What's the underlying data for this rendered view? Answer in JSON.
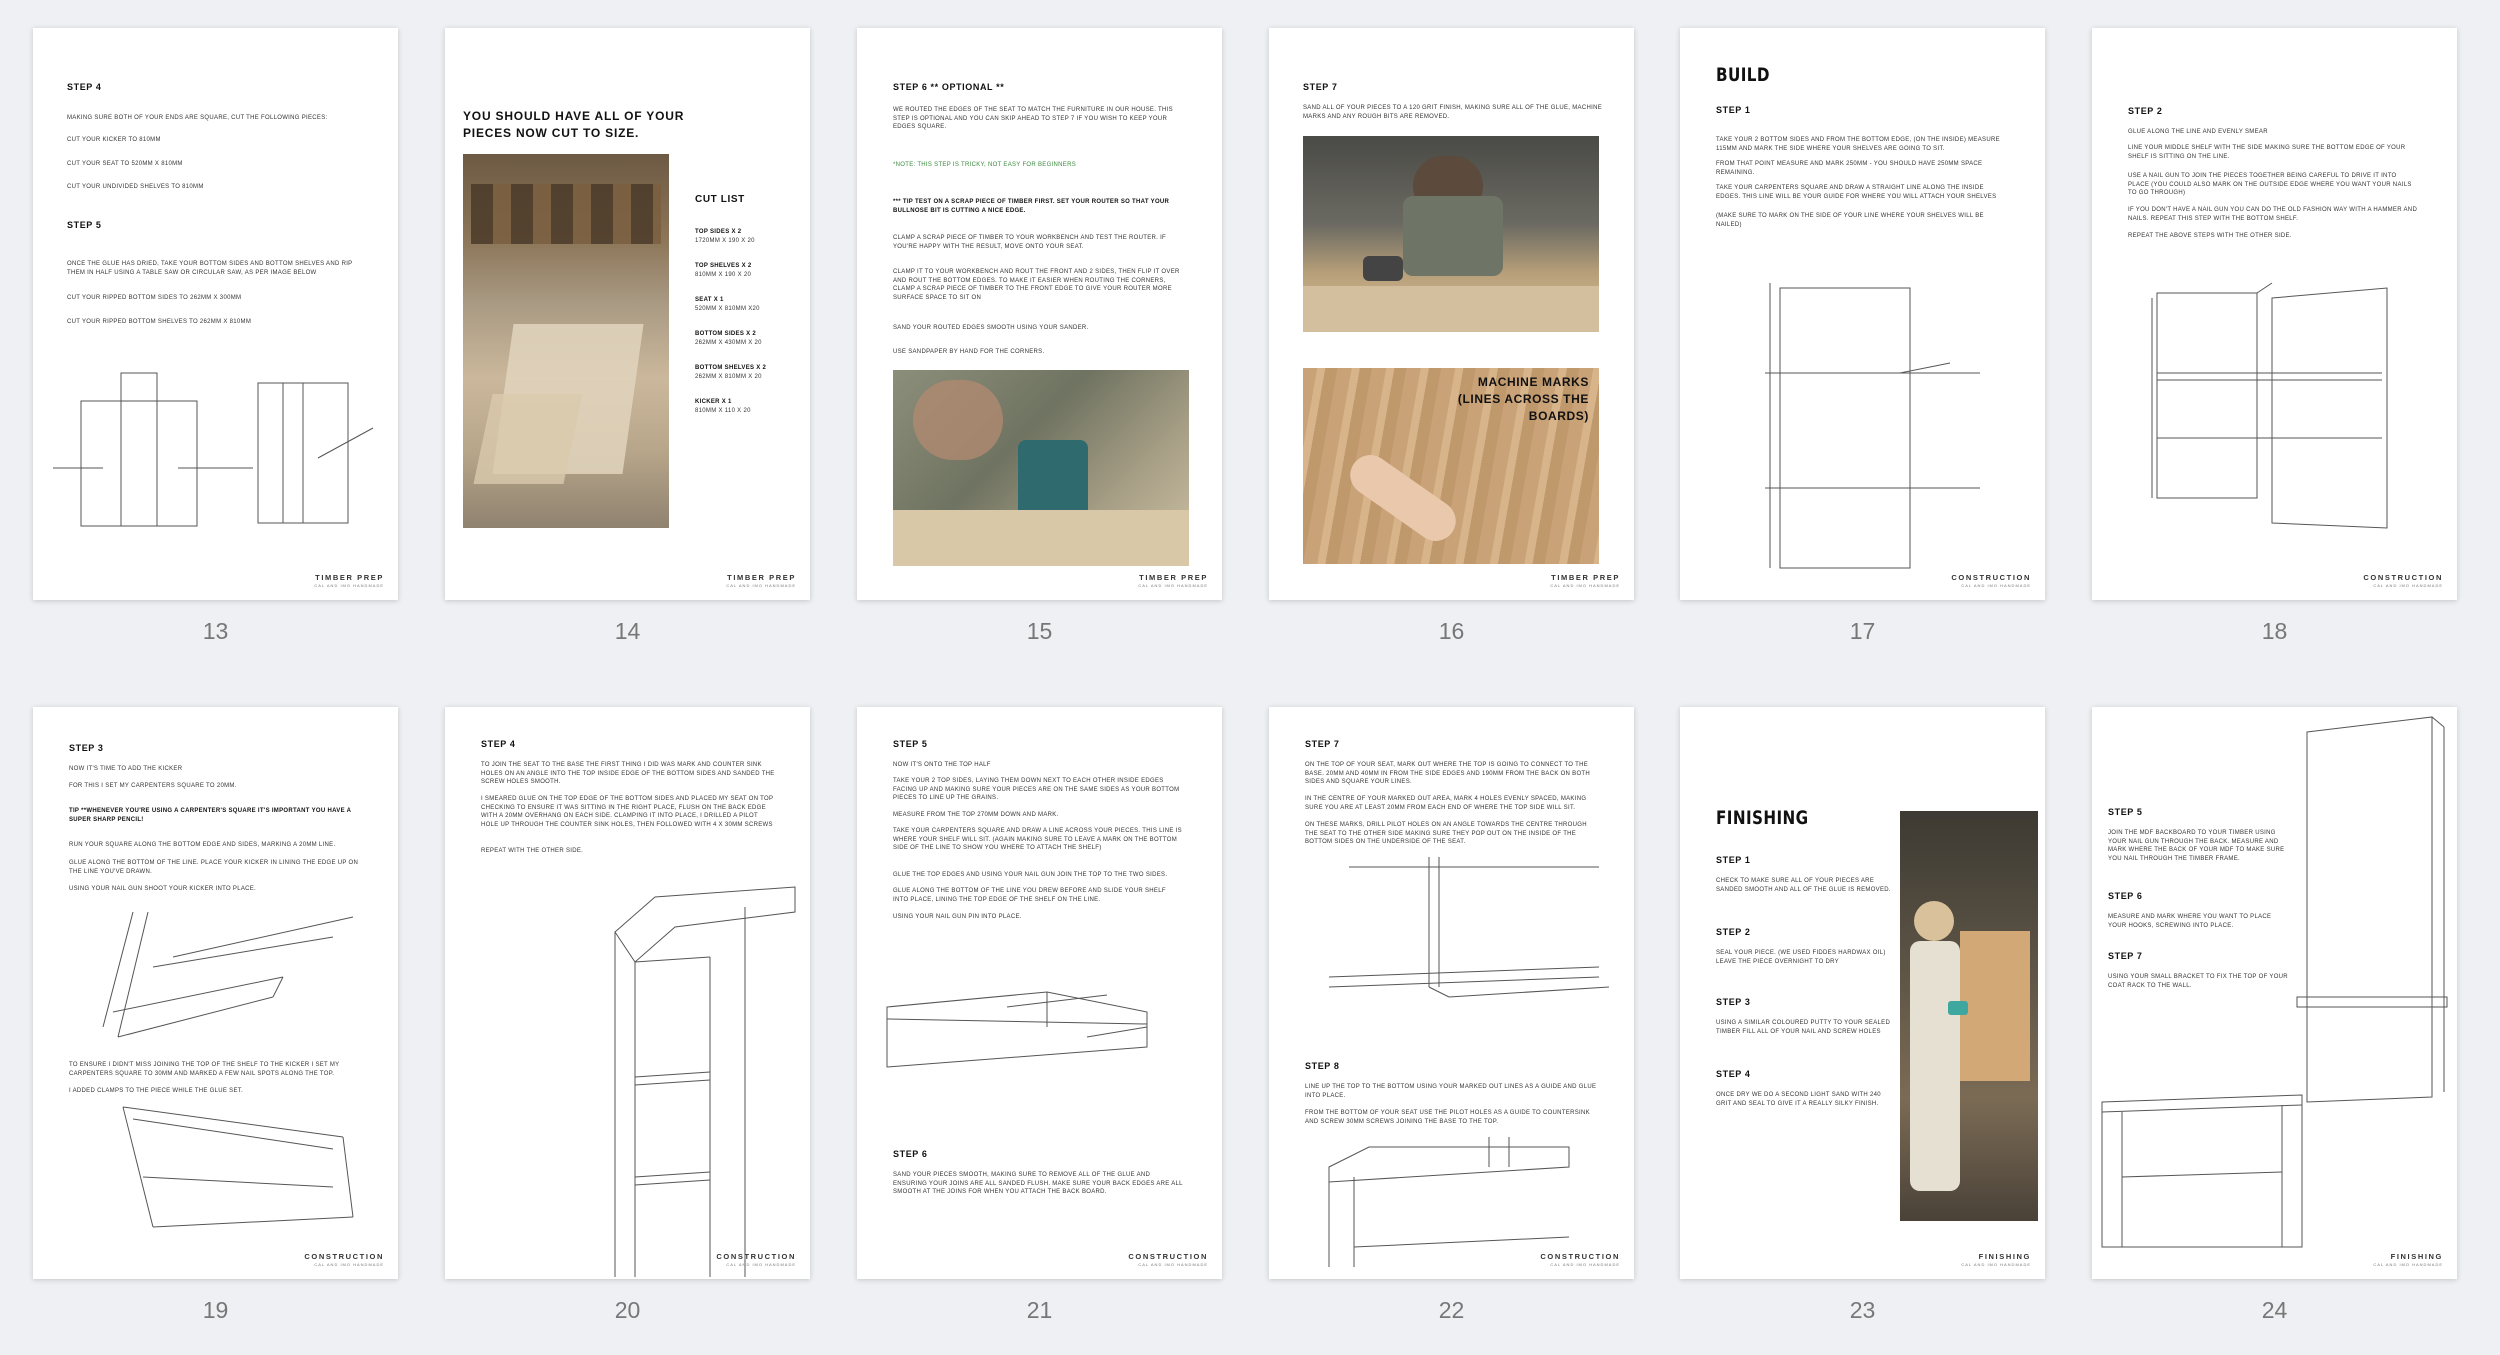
{
  "page_numbers": [
    "13",
    "14",
    "15",
    "16",
    "17",
    "18",
    "19",
    "20",
    "21",
    "22",
    "23",
    "24"
  ],
  "footers": {
    "timber_prep": "TIMBER PREP",
    "construction": "CONSTRUCTION",
    "finishing": "FINISHING",
    "sub": "CAL AND IMO HANDMADE"
  },
  "p13": {
    "step4": "STEP 4",
    "s4_lines": [
      "MAKING SURE BOTH OF YOUR ENDS ARE SQUARE, CUT THE FOLLOWING PIECES:",
      "CUT YOUR KICKER TO 810MM",
      "CUT YOUR SEAT TO 520MM X 810MM",
      "CUT YOUR UNDIVIDED SHELVES TO 810MM"
    ],
    "step5": "STEP 5",
    "s5_lines": [
      "ONCE THE GLUE HAS DRIED, TAKE YOUR BOTTOM SIDES AND BOTTOM SHELVES AND RIP THEM IN HALF USING A TABLE SAW OR CIRCULAR SAW, AS PER IMAGE BELOW",
      "CUT YOUR RIPPED BOTTOM SIDES TO 262MM X 300MM",
      "CUT YOUR RIPPED BOTTOM SHELVES TO 262MM X 810MM"
    ]
  },
  "p14": {
    "heading": "YOU SHOULD HAVE ALL OF YOUR PIECES NOW CUT TO SIZE.",
    "cut_list_title": "CUT LIST",
    "cut_list": [
      {
        "name": "TOP SIDES X 2",
        "dim": "1720MM X 190 X 20"
      },
      {
        "name": "TOP SHELVES X 2",
        "dim": "810MM X 190 X 20"
      },
      {
        "name": "SEAT X 1",
        "dim": "520MM X 810MM X20"
      },
      {
        "name": "BOTTOM SIDES X 2",
        "dim": "262MM X 430MM X 20"
      },
      {
        "name": "BOTTOM SHELVES X 2",
        "dim": "262MM X 810MM X 20"
      },
      {
        "name": "KICKER X 1",
        "dim": "810MM X 110 X 20"
      }
    ]
  },
  "p15": {
    "step": "STEP 6 ** OPTIONAL **",
    "intro": "WE ROUTED THE EDGES OF THE SEAT TO MATCH THE FURNITURE IN OUR HOUSE. THIS STEP IS OPTIONAL AND YOU CAN SKIP AHEAD TO STEP 7 IF YOU WISH TO KEEP YOUR EDGES SQUARE.",
    "note": "*NOTE: THIS STEP IS TRICKY, NOT EASY FOR BEGINNERS",
    "tip": "*** TIP TEST ON A SCRAP PIECE OF TIMBER FIRST. SET YOUR ROUTER SO THAT YOUR BULLNOSE BIT IS CUTTING A NICE EDGE.",
    "lines": [
      "CLAMP A SCRAP PIECE OF TIMBER TO YOUR WORKBENCH AND TEST THE ROUTER. IF YOU'RE HAPPY WITH THE RESULT, MOVE ONTO YOUR SEAT.",
      "CLAMP IT TO YOUR WORKBENCH AND ROUT THE FRONT AND 2 SIDES, THEN FLIP IT OVER AND ROUT THE BOTTOM EDGES. TO MAKE IT EASIER WHEN ROUTING THE CORNERS, CLAMP A SCRAP PIECE OF TIMBER TO THE FRONT EDGE TO GIVE YOUR ROUTER MORE SURFACE SPACE TO SIT ON",
      "SAND YOUR ROUTED EDGES SMOOTH USING YOUR SANDER.",
      "USE SANDPAPER BY HAND FOR THE CORNERS."
    ]
  },
  "p16": {
    "step": "STEP 7",
    "text": "SAND ALL OF YOUR PIECES TO A 120 GRIT FINISH, MAKING SURE ALL OF THE GLUE, MACHINE MARKS AND ANY ROUGH BITS ARE REMOVED.",
    "caption": "MACHINE MARKS (LINES ACROSS THE BOARDS)"
  },
  "p17": {
    "heading": "BUILD",
    "step": "STEP 1",
    "lines": [
      "TAKE YOUR 2 BOTTOM SIDES AND FROM THE BOTTOM EDGE, (ON THE INSIDE) MEASURE 115MM AND MARK THE SIDE WHERE YOUR SHELVES ARE GOING TO SIT.",
      "FROM THAT POINT MEASURE AND MARK 250MM - YOU SHOULD HAVE 250MM SPACE REMAINING.",
      "TAKE YOUR CARPENTERS SQUARE AND DRAW A STRAIGHT LINE ALONG THE INSIDE EDGES. THIS LINE WILL BE YOUR GUIDE FOR WHERE YOU WILL ATTACH YOUR SHELVES",
      "(MAKE SURE TO MARK ON THE SIDE OF YOUR LINE WHERE YOUR SHELVES WILL BE NAILED)"
    ]
  },
  "p18": {
    "step": "STEP 2",
    "lines": [
      "GLUE ALONG THE LINE AND EVENLY SMEAR",
      "LINE YOUR MIDDLE SHELF WITH THE SIDE MAKING SURE THE BOTTOM EDGE OF YOUR SHELF IS SITTING ON THE LINE.",
      "USE A NAIL GUN TO JOIN THE PIECES TOGETHER BEING CAREFUL TO DRIVE IT INTO PLACE (YOU COULD ALSO MARK ON THE OUTSIDE EDGE WHERE YOU WANT YOUR NAILS TO GO THROUGH)",
      "IF YOU DON'T HAVE A NAIL GUN YOU CAN DO THE OLD FASHION WAY WITH A HAMMER AND NAILS. REPEAT THIS STEP WITH THE BOTTOM SHELF.",
      "REPEAT THE ABOVE STEPS WITH THE OTHER SIDE."
    ]
  },
  "p19": {
    "step": "STEP 3",
    "lines": [
      "NOW IT'S TIME TO ADD THE KICKER",
      "FOR THIS I SET MY CARPENTERS SQUARE TO 20MM.",
      "TIP **WHENEVER YOU'RE USING A CARPENTER'S SQUARE IT'S IMPORTANT YOU HAVE A SUPER SHARP PENCIL!",
      "RUN YOUR SQUARE ALONG THE BOTTOM EDGE AND SIDES, MARKING A 20MM LINE.",
      "GLUE ALONG THE BOTTOM OF THE LINE. PLACE YOUR KICKER IN LINING THE EDGE UP ON THE LINE YOU'VE DRAWN.",
      "USING YOUR NAIL GUN SHOOT YOUR KICKER INTO PLACE."
    ],
    "lower": [
      "TO ENSURE I DIDN'T MISS JOINING THE TOP OF THE SHELF TO THE KICKER I SET MY CARPENTERS SQUARE TO 30MM AND MARKED A FEW NAIL SPOTS ALONG THE TOP.",
      "I ADDED CLAMPS TO THE PIECE WHILE THE GLUE SET."
    ]
  },
  "p20": {
    "step": "STEP 4",
    "lines": [
      "TO JOIN THE SEAT TO THE BASE THE FIRST THING I DID WAS MARK AND COUNTER SINK HOLES ON AN ANGLE INTO THE TOP INSIDE EDGE OF THE BOTTOM SIDES AND SANDED THE SCREW HOLES SMOOTH.",
      "I SMEARED GLUE ON THE TOP EDGE OF THE BOTTOM SIDES AND PLACED MY SEAT ON TOP CHECKING TO ENSURE IT WAS SITTING IN THE RIGHT PLACE, FLUSH ON THE BACK EDGE WITH A 20MM OVERHANG ON EACH SIDE. CLAMPING IT INTO PLACE, I DRILLED A PILOT HOLE UP THROUGH THE COUNTER SINK HOLES, THEN FOLLOWED WITH 4 X 30MM SCREWS",
      "REPEAT WITH THE OTHER SIDE."
    ]
  },
  "p21": {
    "step5": "STEP 5",
    "s5_lines": [
      "NOW IT'S ONTO THE TOP HALF",
      "TAKE YOUR 2 TOP SIDES, LAYING THEM DOWN NEXT TO EACH OTHER INSIDE EDGES FACING UP AND MAKING SURE YOUR PIECES ARE ON THE SAME SIDES AS YOUR BOTTOM PIECES TO LINE UP THE GRAINS.",
      "MEASURE FROM THE TOP 270MM DOWN AND MARK.",
      "TAKE YOUR CARPENTERS SQUARE AND DRAW A LINE ACROSS YOUR PIECES. THIS LINE IS WHERE YOUR SHELF WILL SIT. (AGAIN MAKING SURE TO LEAVE A MARK ON THE BOTTOM SIDE OF THE LINE TO SHOW YOU WHERE TO ATTACH THE SHELF)",
      "GLUE THE TOP EDGES AND USING YOUR NAIL GUN JOIN THE TOP TO THE TWO SIDES.",
      "GLUE ALONG THE BOTTOM OF THE LINE YOU DREW BEFORE AND SLIDE YOUR SHELF INTO PLACE, LINING THE TOP EDGE OF THE SHELF ON THE LINE.",
      "USING YOUR NAIL GUN PIN INTO PLACE."
    ],
    "step6": "STEP 6",
    "s6_text": "SAND YOUR PIECES SMOOTH, MAKING SURE TO REMOVE ALL OF THE GLUE AND ENSURING YOUR JOINS ARE ALL SANDED FLUSH. MAKE SURE YOUR BACK EDGES ARE ALL SMOOTH AT THE JOINS FOR WHEN YOU ATTACH THE BACK BOARD."
  },
  "p22": {
    "step7": "STEP 7",
    "s7_lines": [
      "ON THE TOP OF YOUR SEAT, MARK OUT WHERE THE TOP IS GOING TO CONNECT TO THE BASE. 20MM AND 40MM IN FROM THE SIDE EDGES AND 190MM FROM THE BACK ON BOTH SIDES AND SQUARE YOUR LINES.",
      "IN THE CENTRE OF YOUR MARKED OUT AREA, MARK 4 HOLES EVENLY SPACED, MAKING SURE YOU ARE AT LEAST 20MM FROM EACH END OF WHERE THE TOP SIDE WILL SIT.",
      "ON THESE MARKS, DRILL PILOT HOLES ON AN ANGLE TOWARDS THE CENTRE THROUGH THE SEAT TO THE OTHER SIDE MAKING SURE THEY POP OUT ON THE INSIDE OF THE BOTTOM SIDES ON THE UNDERSIDE OF THE SEAT."
    ],
    "step8": "STEP 8",
    "s8_lines": [
      "LINE UP THE TOP TO THE BOTTOM USING YOUR MARKED OUT LINES AS A GUIDE AND GLUE INTO PLACE.",
      "FROM THE BOTTOM OF YOUR SEAT USE THE PILOT HOLES AS A GUIDE TO COUNTERSINK AND SCREW 30MM SCREWS JOINING THE BASE TO THE TOP."
    ]
  },
  "p23": {
    "heading": "FINISHING",
    "steps": [
      {
        "title": "STEP 1",
        "text": "CHECK TO MAKE SURE ALL OF YOUR PIECES ARE SANDED SMOOTH AND ALL OF THE GLUE IS REMOVED."
      },
      {
        "title": "STEP 2",
        "text": "SEAL YOUR PIECE. (WE USED FIDDES HARDWAX OIL) LEAVE THE PIECE OVERNIGHT TO DRY"
      },
      {
        "title": "STEP 3",
        "text": "USING A SIMILAR COLOURED PUTTY TO YOUR SEALED TIMBER FILL ALL OF YOUR NAIL AND SCREW HOLES"
      },
      {
        "title": "STEP 4",
        "text": "ONCE DRY WE DO A SECOND LIGHT SAND WITH 240 GRIT AND SEAL TO GIVE IT A REALLY SILKY FINISH."
      }
    ]
  },
  "p24": {
    "steps": [
      {
        "title": "STEP 5",
        "text": "JOIN THE MDF BACKBOARD TO YOUR TIMBER USING YOUR NAIL GUN THROUGH THE BACK. MEASURE AND MARK WHERE THE BACK OF YOUR MDF TO MAKE SURE YOU NAIL THROUGH THE TIMBER FRAME."
      },
      {
        "title": "STEP 6",
        "text": "MEASURE AND MARK WHERE YOU WANT TO PLACE YOUR HOOKS, SCREWING INTO PLACE."
      },
      {
        "title": "STEP 7",
        "text": "USING YOUR SMALL BRACKET TO FIX THE TOP OF YOUR COAT RACK TO THE WALL."
      }
    ]
  }
}
